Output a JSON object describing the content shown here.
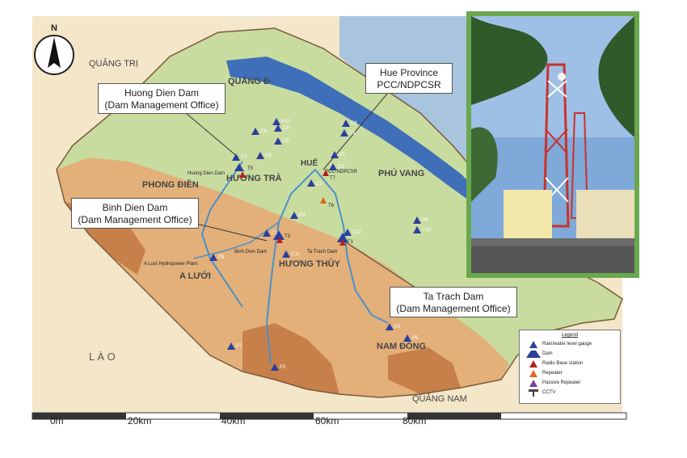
{
  "north_label": "N",
  "photo": {
    "description_icon": "radio-tower-photo"
  },
  "regions": {
    "quang_tri": "QUẢNG TRỊ",
    "quang_dien": "QUẢNG Đ",
    "phong_dien": "PHONG ĐIỀN",
    "huong_tra": "HƯƠNG TRÀ",
    "hue": "HUẾ",
    "phu_vang": "PHÚ VANG",
    "huong_thuy": "HƯƠNG THỦY",
    "a_luoi": "A LƯỚI",
    "lao": "L À O",
    "nam_dong": "NAM ĐÔNG",
    "quang_nam": "QUẢNG NAM"
  },
  "callouts": {
    "huong_dien": [
      "Huong Dien Dam",
      "(Dam Management Office)"
    ],
    "binh_dien": [
      "Binh Dien Dam",
      "(Dam Management Office)"
    ],
    "hue_pcc": [
      "Hue Province",
      "PCC/NDPCSR"
    ],
    "ta_trach": [
      "Ta Trach Dam",
      "(Dam Management Office)"
    ]
  },
  "map_labels": {
    "huong_dien_dam": "Huong Dien Dam",
    "binh_dien_dam": "Binh Dien Dam",
    "ta_trach_dam": "Ta Trach Dam",
    "pcc_ndpcsr": "PCC-NDPCSR",
    "a_luoi_plant": "A Luoi Hydropower Plant"
  },
  "station_codes": {
    "c1": "C1",
    "c2": "C2",
    "c3": "C3",
    "c4": "C4",
    "c5": "C5",
    "c6": "C6",
    "c7": "C7",
    "c8": "C8",
    "c9": "C9",
    "c10": "C10",
    "c11": "C11",
    "c12": "C12",
    "c14": "C14",
    "p1": "P1",
    "p2": "P2",
    "p3": "P3",
    "p4": "P4",
    "p5": "P5",
    "p6": "P6",
    "p7": "P7",
    "p8": "P8",
    "p10": "P10",
    "t1": "T1",
    "t3": "T3",
    "t5": "T5",
    "t6": "T6",
    "t7": "T7"
  },
  "legend": {
    "title": "Legend",
    "items": [
      {
        "label": "Rain/water level gauge",
        "symbol": "blue-triangle-icon",
        "color": "#2b3f9e"
      },
      {
        "label": "Dam",
        "symbol": "dam-icon",
        "color": "#2b3f9e"
      },
      {
        "label": "Radio Base station",
        "symbol": "red-triangle-icon",
        "color": "#b22222"
      },
      {
        "label": "Repeater",
        "symbol": "orange-triangle-icon",
        "color": "#e0641e"
      },
      {
        "label": "Passive Repeater",
        "symbol": "purple-triangle-icon",
        "color": "#7a3fa0"
      },
      {
        "label": "CCTV",
        "symbol": "cctv-icon",
        "color": "#444444"
      }
    ]
  },
  "scale": {
    "labels": [
      "0m",
      "20km",
      "40km",
      "60km",
      "80km"
    ]
  },
  "colors": {
    "lowland": "#c9dca0",
    "highland": "#e3b07a",
    "mountain": "#c8804a",
    "lagoon": "#3f6fb8",
    "sea": "#a9c4de",
    "river": "#4a90c8"
  }
}
